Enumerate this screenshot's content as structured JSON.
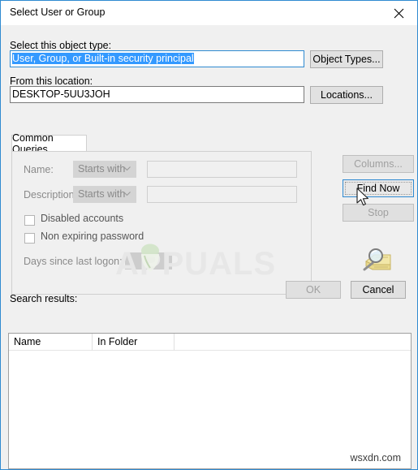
{
  "window": {
    "title": "Select User or Group",
    "close_icon": "close-icon",
    "accent_color": "#2f8ad1",
    "background": "#f0f0f0"
  },
  "object_type": {
    "label": "Select this object type:",
    "value": "User, Group, or Built-in security principal",
    "selected": true,
    "button_label": "Object Types..."
  },
  "location": {
    "label": "From this location:",
    "value": "DESKTOP-5UU3JOH",
    "button_label": "Locations..."
  },
  "tab": {
    "label": "Common Queries"
  },
  "query": {
    "name_label": "Name:",
    "name_condition": "Starts with",
    "name_value": "",
    "description_label": "Description:",
    "description_condition": "Starts with",
    "description_value": "",
    "disabled_accounts_label": "Disabled accounts",
    "disabled_accounts_checked": false,
    "non_expiring_label": "Non expiring password",
    "non_expiring_checked": false,
    "days_since_logon_label": "Days since last logon:",
    "days_since_logon_value": ""
  },
  "side_buttons": {
    "columns_label": "Columns...",
    "columns_enabled": false,
    "find_now_label": "Find Now",
    "find_now_enabled": true,
    "stop_label": "Stop",
    "stop_enabled": false,
    "find_icon": "magnifier-folder-icon"
  },
  "dialog_buttons": {
    "ok_label": "OK",
    "ok_enabled": false,
    "cancel_label": "Cancel",
    "cancel_enabled": true
  },
  "results": {
    "label": "Search results:",
    "columns": [
      "Name",
      "In Folder",
      ""
    ],
    "rows": []
  },
  "watermarks": {
    "brand": "PPUALS",
    "brand_first_letter": "A",
    "site": "wsxdn.com"
  }
}
